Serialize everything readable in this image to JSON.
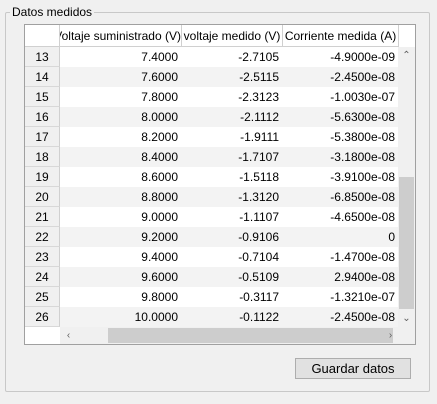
{
  "group": {
    "title": "Datos medidos"
  },
  "table": {
    "columns": [
      "Voltaje suministrado (V)",
      "voltaje medido (V)",
      "Corriente medida (A)"
    ],
    "rows": [
      {
        "n": "13",
        "v1": "7.4000",
        "v2": "-2.7105",
        "i": "-4.9000e-09"
      },
      {
        "n": "14",
        "v1": "7.6000",
        "v2": "-2.5115",
        "i": "-2.4500e-08"
      },
      {
        "n": "15",
        "v1": "7.8000",
        "v2": "-2.3123",
        "i": "-1.0030e-07"
      },
      {
        "n": "16",
        "v1": "8.0000",
        "v2": "-2.1112",
        "i": "-5.6300e-08"
      },
      {
        "n": "17",
        "v1": "8.2000",
        "v2": "-1.9111",
        "i": "-5.3800e-08"
      },
      {
        "n": "18",
        "v1": "8.4000",
        "v2": "-1.7107",
        "i": "-3.1800e-08"
      },
      {
        "n": "19",
        "v1": "8.6000",
        "v2": "-1.5118",
        "i": "-3.9100e-08"
      },
      {
        "n": "20",
        "v1": "8.8000",
        "v2": "-1.3120",
        "i": "-6.8500e-08"
      },
      {
        "n": "21",
        "v1": "9.0000",
        "v2": "-1.1107",
        "i": "-4.6500e-08"
      },
      {
        "n": "22",
        "v1": "9.2000",
        "v2": "-0.9106",
        "i": "0"
      },
      {
        "n": "23",
        "v1": "9.4000",
        "v2": "-0.7104",
        "i": "-1.4700e-08"
      },
      {
        "n": "24",
        "v1": "9.6000",
        "v2": "-0.5109",
        "i": "2.9400e-08"
      },
      {
        "n": "25",
        "v1": "9.8000",
        "v2": "-0.3117",
        "i": "-1.3210e-07"
      },
      {
        "n": "26",
        "v1": "10.0000",
        "v2": "-0.1122",
        "i": "-2.4500e-08"
      }
    ]
  },
  "button": {
    "save_label": "Guardar datos"
  },
  "icons": {
    "up": "chevron-up-icon",
    "down": "chevron-down-icon",
    "left": "chevron-left-icon",
    "right": "chevron-right-icon"
  }
}
